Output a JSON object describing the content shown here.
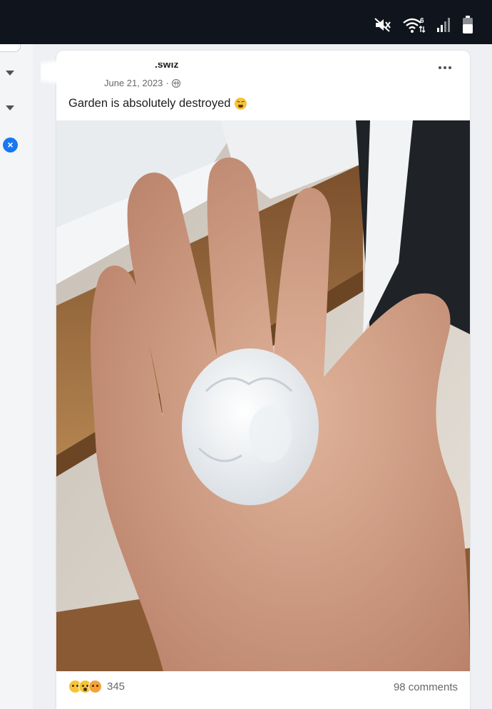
{
  "post": {
    "author_fragment": ".swiz",
    "date": "June 21, 2023",
    "separator": "·",
    "text": "Garden is absolutely destroyed",
    "text_emoji_icon": "tired-face-emoji-icon",
    "reactions": [
      "sad-reaction-icon",
      "wow-reaction-icon",
      "care-reaction-icon"
    ],
    "reaction_count": "345",
    "comments": "98 comments"
  },
  "colors": {
    "status_bar": "#10141c",
    "accent": "#1877f2",
    "background": "#eef0f3"
  }
}
